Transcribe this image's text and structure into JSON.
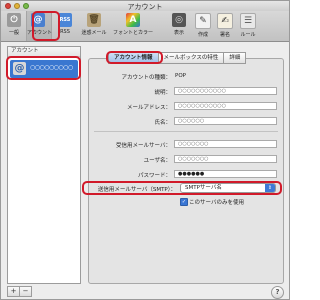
{
  "window": {
    "title": "アカウント"
  },
  "toolbar": {
    "items": [
      {
        "label": "一般",
        "icon": "switch-icon"
      },
      {
        "label": "アカウント",
        "icon": "at-sign-icon"
      },
      {
        "label": "RSS",
        "icon": "rss-icon"
      },
      {
        "label": "迷惑メール",
        "icon": "trash-can-icon"
      },
      {
        "label": "フォントとカラー",
        "icon": "font-color-icon"
      },
      {
        "label": "表示",
        "icon": "glasses-icon"
      },
      {
        "label": "作成",
        "icon": "pencil-icon"
      },
      {
        "label": "署名",
        "icon": "pen-icon"
      },
      {
        "label": "ルール",
        "icon": "rules-icon"
      }
    ],
    "glyphs": {
      "general": "⏻",
      "account": "@",
      "rss": "RSS",
      "junk": "🗑",
      "fonts": "A",
      "view": "◎",
      "compose": "✎",
      "signature": "✍",
      "rules": "☰"
    }
  },
  "sidebar": {
    "header": "アカウント",
    "account_name": "○○○○○○○○○",
    "account_icon": "@",
    "add": "+",
    "remove": "−"
  },
  "tabs": [
    "アカウント情報",
    "メールボックスの特性",
    "詳細"
  ],
  "form": {
    "account_type_label": "アカウントの種類：",
    "account_type_value": "POP",
    "description_label": "説明：",
    "description_value": "○○○○○○○○○○○",
    "email_label": "メールアドレス：",
    "email_value": "○○○○○○○○○○○",
    "name_label": "氏名：",
    "name_value": "○○○○○○",
    "incoming_server_label": "受信用メールサーバ：",
    "incoming_server_value": "○○○○○○○",
    "username_label": "ユーザ名：",
    "username_value": "○○○○○○○",
    "password_label": "パスワード：",
    "password_value": "●●●●●●",
    "smtp_label": "送信用メールサーバ（SMTP）：",
    "smtp_value": "SMTPサーバ名",
    "smtp_arrows": "⇕",
    "only_this_server_label": "このサーバのみを使用",
    "only_this_server_checked": true,
    "check_mark": "✓"
  },
  "help": "?",
  "colors": {
    "highlight": "#d11a2a",
    "selection": "#3a77d0"
  }
}
